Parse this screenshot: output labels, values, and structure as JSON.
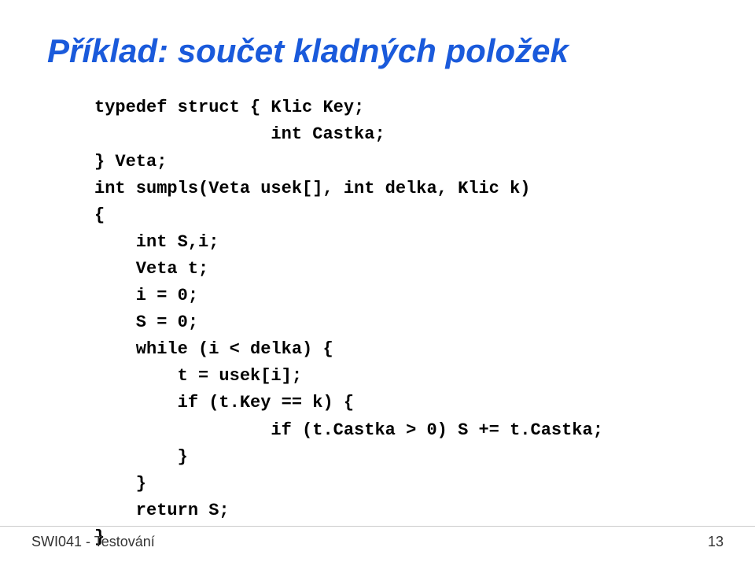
{
  "slide": {
    "title": "Příklad: součet kladných položek",
    "code_lines": [
      "typedef struct { Klic Key;",
      "                 int Castka;",
      "} Veta;",
      "",
      "int sumpls(Veta usek[], int delka, Klic k)",
      "{",
      "    int S,i;",
      "    Veta t;",
      "",
      "    i = 0;",
      "    S = 0;",
      "    while (i < delka) {",
      "        t = usek[i];",
      "        if (t.Key == k) {",
      "                 if (t.Castka > 0) S += t.Castka;",
      "        }",
      "    }",
      "    return S;",
      "}"
    ],
    "footer": {
      "left": "SWI041 - Testování",
      "right": "13"
    }
  }
}
